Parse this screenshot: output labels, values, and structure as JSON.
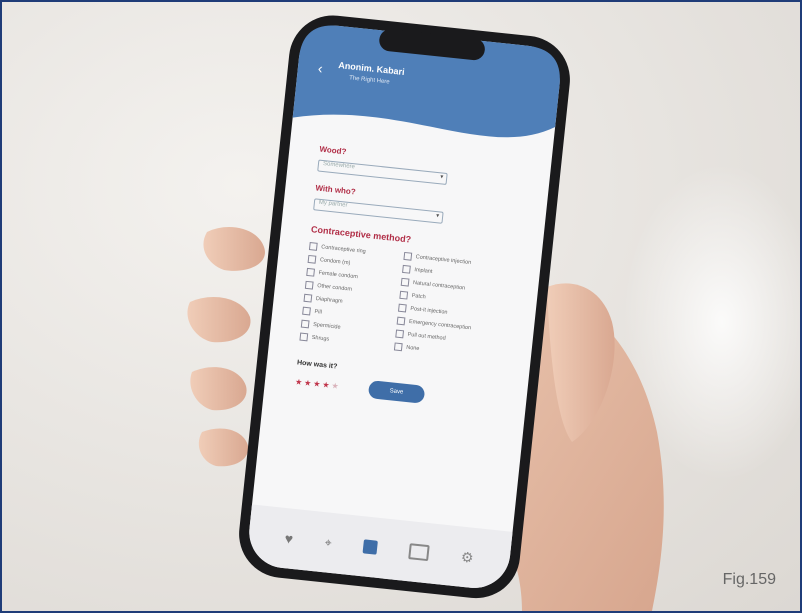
{
  "figure": {
    "label": "Fig.159"
  },
  "app": {
    "header_title": "Anonim. Kabari",
    "header_subtitle": "The Right Here",
    "sections": [
      {
        "label": "Wood?",
        "select_value": "Somewhere"
      },
      {
        "label": "With who?",
        "select_value": "My partner"
      }
    ],
    "contraceptive_title": "Contraceptive method?",
    "methods_left": [
      "Contraceptive ring",
      "Condom (m)",
      "Female condom",
      "Other condom",
      "Diaphragm",
      "Pill",
      "Spermicide",
      "Shrugs"
    ],
    "methods_right": [
      "Contraceptive injection",
      "Implant",
      "Natural contraception",
      "Patch",
      "Post-it injection",
      "Emergency contraception",
      "Pull out method",
      "None"
    ],
    "rating_label": "How was it?",
    "rating_value": 4,
    "rating_max": 5,
    "save_label": "Save",
    "nav_icons": [
      "heart-icon",
      "pin-icon",
      "calendar-icon",
      "card-icon",
      "gear-icon"
    ],
    "colors": {
      "accent": "#3f6ea8",
      "star": "#c0344a",
      "header_blue": "#4f7fb8"
    }
  }
}
